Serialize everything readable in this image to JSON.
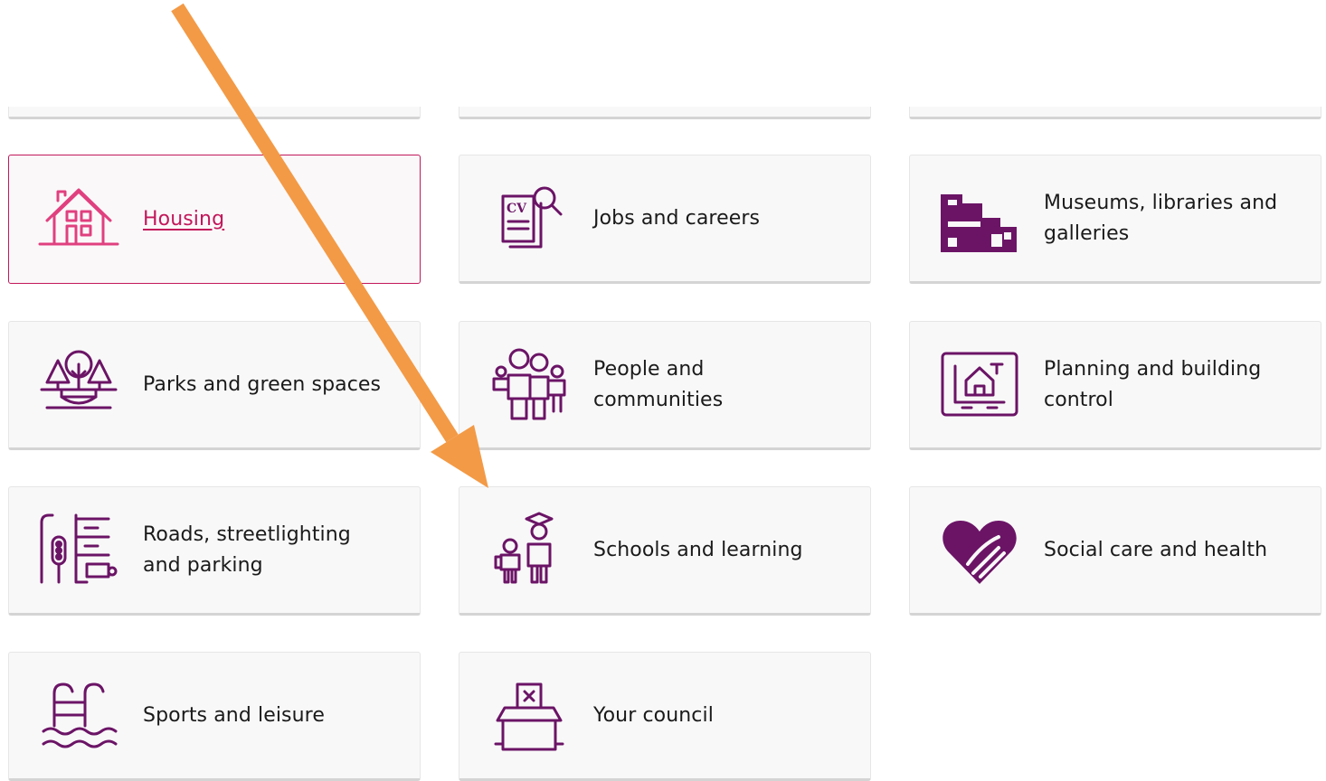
{
  "colors": {
    "icon": "#6b1466",
    "active": "#c2185b",
    "arrow": "#f39a46",
    "card_bg": "#f8f8f8"
  },
  "cards": [
    {
      "label": "Housing",
      "icon": "house-icon",
      "state": "hover-focus"
    },
    {
      "label": "Jobs and careers",
      "icon": "cv-search-icon"
    },
    {
      "label": "Museums, libraries and galleries",
      "icon": "museum-building-icon"
    },
    {
      "label": "Parks and green spaces",
      "icon": "trees-park-icon"
    },
    {
      "label": "People and communities",
      "icon": "people-group-icon"
    },
    {
      "label": "Planning and building control",
      "icon": "house-blueprint-icon"
    },
    {
      "label": "Roads, streetlighting and parking",
      "icon": "traffic-light-road-icon"
    },
    {
      "label": "Schools and learning",
      "icon": "graduate-child-icon"
    },
    {
      "label": "Social care and health",
      "icon": "heart-hand-icon"
    },
    {
      "label": "Sports and leisure",
      "icon": "swimming-pool-icon"
    },
    {
      "label": "Your council",
      "icon": "ballot-box-icon"
    }
  ],
  "annotation": {
    "type": "arrow",
    "target": "Schools and learning"
  }
}
